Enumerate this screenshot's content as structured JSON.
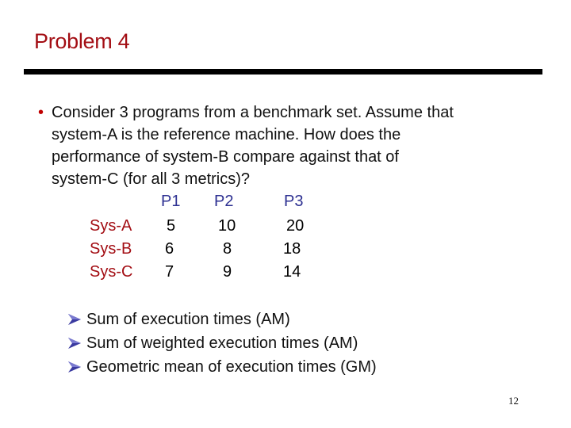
{
  "slide": {
    "title": "Problem 4",
    "question_lines": [
      "Consider 3 programs from a benchmark set.  Assume that",
      "system-A is the reference machine.  How does the",
      "performance of system-B compare against that of",
      "system-C (for all 3 metrics)?"
    ],
    "table": {
      "columns": [
        "P1",
        "P2",
        "P3"
      ],
      "rows": [
        {
          "label": "Sys-A",
          "values": [
            "5",
            "10",
            "20"
          ]
        },
        {
          "label": "Sys-B",
          "values": [
            "6",
            "8",
            "18"
          ]
        },
        {
          "label": "Sys-C",
          "values": [
            "7",
            "9",
            "14"
          ]
        }
      ]
    },
    "metrics": [
      "Sum of execution times (AM)",
      "Sum of weighted execution times (AM)",
      "Geometric mean of execution times (GM)"
    ],
    "page_number": "12",
    "colors": {
      "title": "#a30e14",
      "header": "#2e3192",
      "bullet_arrow": "#3a3aa0"
    }
  }
}
